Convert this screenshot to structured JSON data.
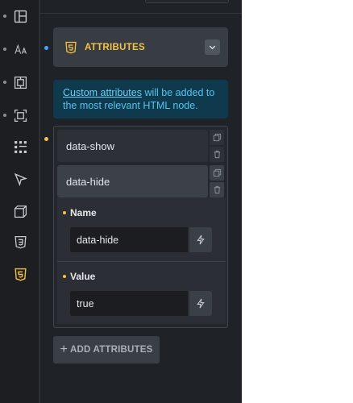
{
  "rail": {
    "items": [
      {
        "icon": "layout-icon",
        "active": false
      },
      {
        "icon": "typography-icon",
        "active": false
      },
      {
        "icon": "spacing-icon",
        "active": false
      },
      {
        "icon": "sizing-icon",
        "active": false
      },
      {
        "icon": "grid-dots-icon",
        "active": false
      },
      {
        "icon": "cursor-icon",
        "active": false
      },
      {
        "icon": "cube-icon",
        "active": false
      },
      {
        "icon": "css3-icon",
        "active": false
      },
      {
        "icon": "html5-icon",
        "active": true
      }
    ]
  },
  "section": {
    "title": "ATTRIBUTES",
    "icon": "html5-icon"
  },
  "info": {
    "link_text": "Custom attributes",
    "text": " will be added to the most relevant HTML node."
  },
  "attributes": [
    {
      "name": "data-show"
    },
    {
      "name": "data-hide"
    }
  ],
  "editor": {
    "name_label": "Name",
    "name_value": "data-hide",
    "value_label": "Value",
    "value_value": "true"
  },
  "add_button": {
    "label": "ADD ATTRIBUTES"
  },
  "colors": {
    "accent": "#f5c344",
    "info_text": "#56c1ee",
    "info_bg": "#0f3a4d",
    "blue_indicator": "#4aa3ff"
  }
}
